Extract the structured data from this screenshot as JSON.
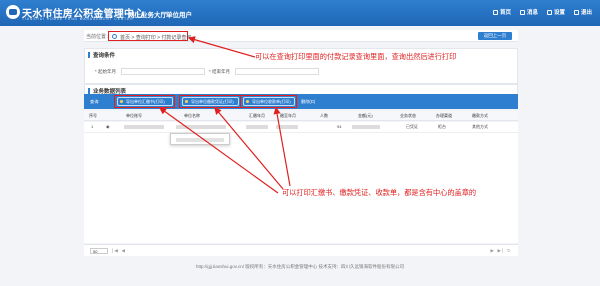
{
  "header": {
    "brand_cn": "天水市住房公积金管理中心",
    "brand_en": "TIANSHUI   HOUSE   FUND   MANAGEMENT   CENTER",
    "hall": "网上业务大厅",
    "unit_user": "单位用户",
    "links": [
      {
        "icon": "home-icon",
        "label": "首页"
      },
      {
        "icon": "message-icon",
        "label": "消息"
      },
      {
        "icon": "setting-icon",
        "label": "设置"
      },
      {
        "icon": "exit-icon",
        "label": "退出"
      }
    ]
  },
  "breadcrumb": {
    "label": "当前位置：",
    "path": "首页 > 查询打印 > 付款记录查询",
    "back": "返回上一页"
  },
  "query": {
    "title": "查询条件",
    "start_label": "* 起始年月",
    "end_label": "* 结束年月"
  },
  "list": {
    "title": "业务数据列表",
    "toolbar": {
      "query": "查询",
      "print_summary": "导出单位汇缴书(打印)",
      "print_voucher": "导出单位缴款凭证(打印)",
      "print_receipt": "导出单位收款单(打印)",
      "delete": "删除(D)"
    },
    "columns": [
      "序号",
      "",
      "单位账号",
      "单位名称",
      "汇缴年月",
      "缴至年月",
      "人数",
      "金额(元)",
      "业务状态",
      "办理渠道",
      "缴款方式"
    ],
    "rows": [
      {
        "no": "1",
        "flag": "◉",
        "count": "94",
        "status": "已凭证",
        "channel": "柜台",
        "method": "其他方式"
      }
    ]
  },
  "pager": {
    "size": "50",
    "left_arrows": "|◀ ◀",
    "right_arrows": "▶ ▶| ↻"
  },
  "annotations": {
    "top": "可以在查询打印里面的付款记录查询里面，查询出然后进行打印",
    "bottom": "可以打印汇缴书、缴款凭证、收款单，都是含有中心的盖章的"
  },
  "footer": "http://gjj.tianshui.gov.cn/ 版权所有：天水住房公积金管理中心 技术支持：四川久远银海软件股份有限公司",
  "colors": {
    "brand": "#2f7fd0",
    "annotation": "#e02020"
  }
}
